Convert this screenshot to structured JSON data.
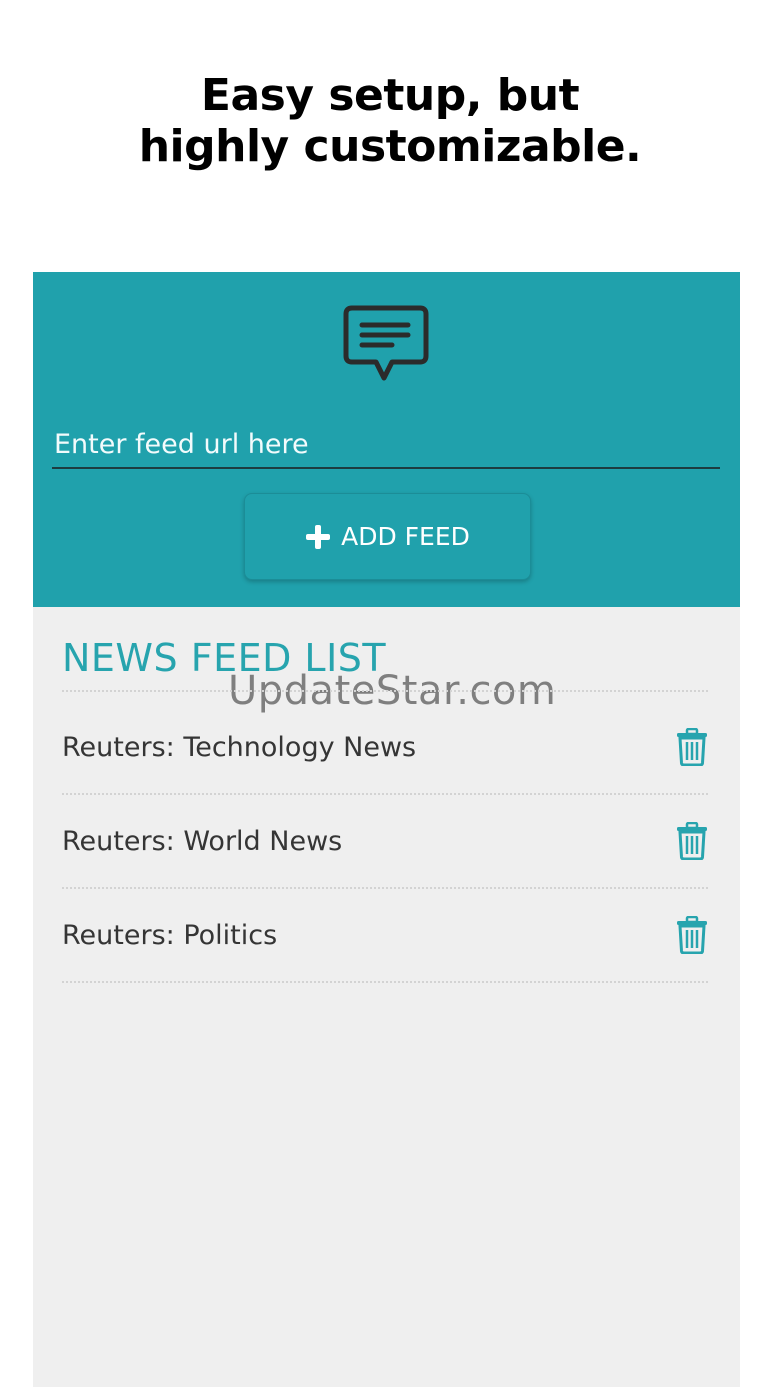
{
  "headline": {
    "line1": "Easy setup, but",
    "line2": "highly customizable."
  },
  "icons": {
    "header": "chat-bubble-icon",
    "add": "plus-icon",
    "delete": "trash-icon"
  },
  "colors": {
    "accent": "#20a1ac",
    "list_title": "#27a4ae",
    "background": "#efefef"
  },
  "feed_input": {
    "placeholder": "Enter feed url here",
    "value": ""
  },
  "add_button": {
    "label": "ADD FEED"
  },
  "list": {
    "title": "NEWS FEED LIST",
    "items": [
      {
        "name": "Reuters: Technology News"
      },
      {
        "name": "Reuters: World News"
      },
      {
        "name": "Reuters: Politics"
      }
    ]
  },
  "watermark": "UpdateStar.com"
}
